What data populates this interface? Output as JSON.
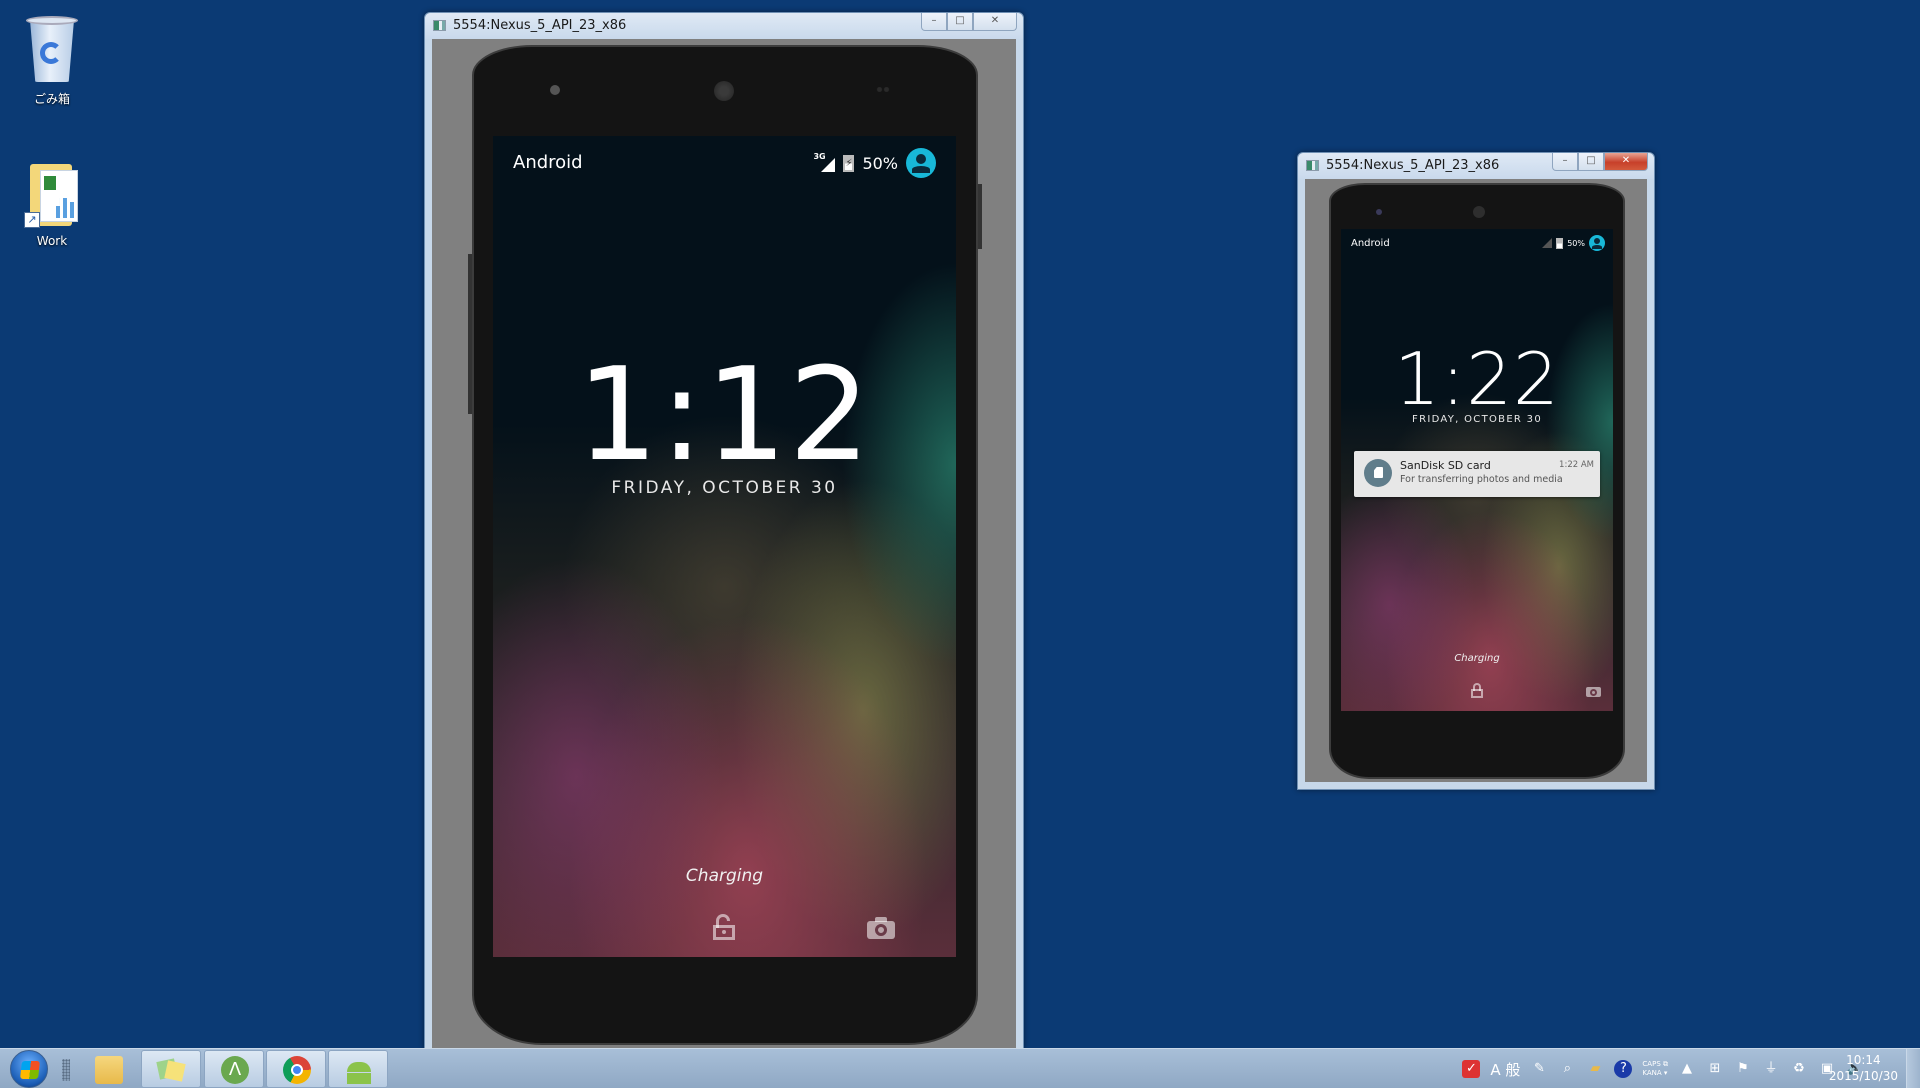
{
  "desktop": {
    "icons": [
      {
        "label": "ごみ箱",
        "icon": "recycle-bin-icon"
      },
      {
        "label": "Work",
        "icon": "folder-shortcut-icon"
      }
    ]
  },
  "windows": [
    {
      "title": "5554:Nexus_5_API_23_x86",
      "controls": {
        "minimize": "–",
        "maximize": "□",
        "close": "✕"
      },
      "phone": {
        "status_bar": {
          "carrier": "Android",
          "network": "3G",
          "battery": "50%",
          "battery_level": 0.5
        },
        "time": "1:12",
        "date": "FRIDAY, OCTOBER 30",
        "status_text": "Charging",
        "icons": [
          "unlock-icon",
          "camera-icon"
        ]
      }
    },
    {
      "title": "5554:Nexus_5_API_23_x86",
      "controls": {
        "minimize": "–",
        "maximize": "□",
        "close": "✕"
      },
      "phone": {
        "status_bar": {
          "carrier": "Android",
          "battery": "50%",
          "battery_level": 0.5
        },
        "time": "1:22",
        "date": "FRIDAY, OCTOBER 30",
        "notification": {
          "title": "SanDisk SD card",
          "text": "For transferring photos and media",
          "time": "1:22 AM"
        },
        "status_text": "Charging",
        "icons": [
          "unlock-icon",
          "camera-icon"
        ]
      }
    }
  ],
  "taskbar": {
    "apps": [
      "explorer",
      "sticky-notes",
      "android-studio",
      "chrome",
      "android-emulator"
    ],
    "tray": {
      "ime": "A 般",
      "caps": "CAPS",
      "kana": "KANA",
      "clock_time": "10:14",
      "clock_date": "2015/10/30"
    }
  },
  "colors": {
    "desktop": "#0b3a74",
    "accent_avatar": "#18b8d8",
    "notif_icon": "#607d8b"
  }
}
